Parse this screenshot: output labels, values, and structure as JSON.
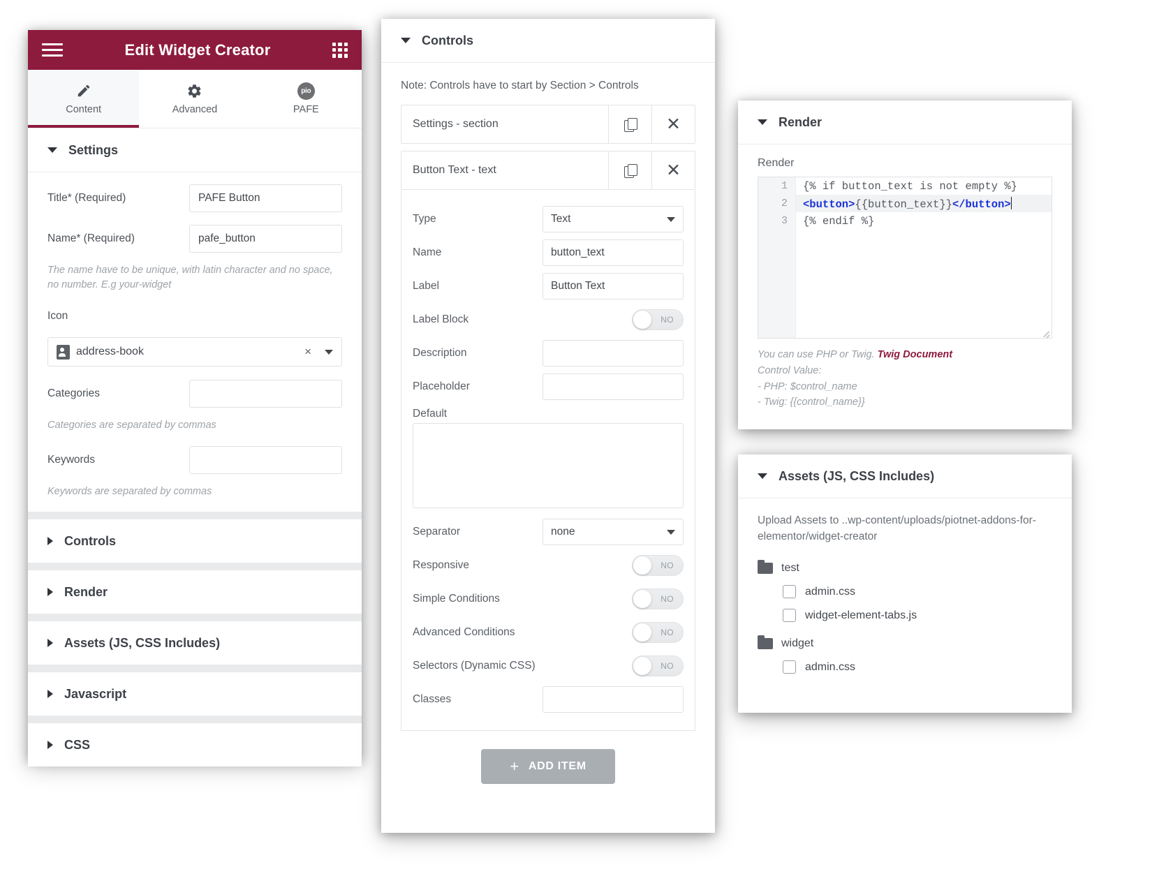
{
  "left_panel": {
    "header": {
      "title": "Edit Widget Creator",
      "menu_icon": "hamburger-menu-icon",
      "grid_icon": "grid-apps-icon"
    },
    "tabs": [
      {
        "label": "Content",
        "icon": "pencil-icon",
        "active": true
      },
      {
        "label": "Advanced",
        "icon": "gear-icon",
        "active": false
      },
      {
        "label": "PAFE",
        "icon": "pio-logo-icon",
        "active": false
      }
    ],
    "settings_section": {
      "title": "Settings",
      "fields": {
        "title_label": "Title* (Required)",
        "title_value": "PAFE Button",
        "name_label": "Name* (Required)",
        "name_value": "pafe_button",
        "name_hint": "The name have to be unique, with latin character and no space, no number. E.g your-widget",
        "icon_label": "Icon",
        "icon_value": "address-book",
        "icon_clear": "×",
        "categories_label": "Categories",
        "categories_value": "",
        "categories_hint": "Categories are separated by commas",
        "keywords_label": "Keywords",
        "keywords_value": "",
        "keywords_hint": "Keywords are separated by commas"
      }
    },
    "collapsed_sections": [
      {
        "label": "Controls"
      },
      {
        "label": "Render"
      },
      {
        "label": "Assets (JS, CSS Includes)"
      },
      {
        "label": "Javascript"
      },
      {
        "label": "CSS"
      }
    ]
  },
  "mid_panel": {
    "title": "Controls",
    "note": "Note: Controls have to start by Section > Controls",
    "items": [
      {
        "label": "Settings - section"
      },
      {
        "label": "Button Text - text"
      }
    ],
    "detail": {
      "type_label": "Type",
      "type_value": "Text",
      "name_label": "Name",
      "name_value": "button_text",
      "label_label": "Label",
      "label_value": "Button Text",
      "label_block_label": "Label Block",
      "label_block_state": "NO",
      "description_label": "Description",
      "description_value": "",
      "placeholder_label": "Placeholder",
      "placeholder_value": "",
      "default_label": "Default",
      "default_value": "",
      "separator_label": "Separator",
      "separator_value": "none",
      "responsive_label": "Responsive",
      "responsive_state": "NO",
      "simple_conditions_label": "Simple Conditions",
      "simple_conditions_state": "NO",
      "advanced_conditions_label": "Advanced Conditions",
      "advanced_conditions_state": "NO",
      "selectors_label": "Selectors (Dynamic CSS)",
      "selectors_state": "NO",
      "classes_label": "Classes",
      "classes_value": ""
    },
    "add_item_label": "ADD ITEM",
    "add_item_plus": "+"
  },
  "render_panel": {
    "title": "Render",
    "sub_label": "Render",
    "code": [
      {
        "n": "1",
        "text": "{% if button_text is not empty %}",
        "highlight": false
      },
      {
        "n": "2",
        "text": "<button>{{button_text}}</button>",
        "highlight": true
      },
      {
        "n": "3",
        "text": "{% endif %}",
        "highlight": false
      }
    ],
    "foot_line1_a": "You can use PHP or Twig. ",
    "foot_link": "Twig Document",
    "foot_line2": "Control Value:",
    "foot_line3": "- PHP: $control_name",
    "foot_line4": "- Twig: {{control_name}}"
  },
  "assets_panel": {
    "title": "Assets (JS, CSS Includes)",
    "note": "Upload Assets to ..wp-content/uploads/piotnet-addons-for-elementor/widget-creator",
    "tree": [
      {
        "folder": "test",
        "files": [
          "admin.css",
          "widget-element-tabs.js"
        ]
      },
      {
        "folder": "widget",
        "files": [
          "admin.css"
        ]
      }
    ]
  },
  "colors": {
    "brand": "#8d1b3d",
    "code_tag": "#1a34d8",
    "band": "#e8eaec"
  }
}
